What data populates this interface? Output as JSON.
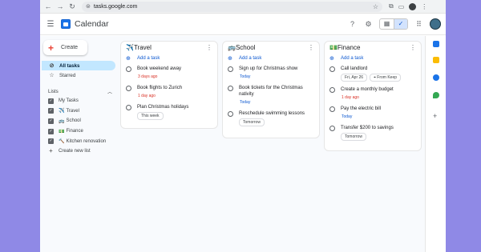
{
  "browser": {
    "url": "tasks.google.com"
  },
  "header": {
    "app_title": "Calendar"
  },
  "sidebar": {
    "create_label": "Create",
    "all_tasks": "All tasks",
    "starred": "Starred",
    "lists_label": "Lists",
    "lists": [
      {
        "emoji": "",
        "label": "My Tasks"
      },
      {
        "emoji": "✈️",
        "label": "Travel"
      },
      {
        "emoji": "🚌",
        "label": "School"
      },
      {
        "emoji": "💵",
        "label": "Finance"
      },
      {
        "emoji": "🔨",
        "label": "Kitchen renovation"
      }
    ],
    "create_new_list": "Create new list"
  },
  "boards": [
    {
      "title": "✈️Travel",
      "add_task": "Add a task",
      "tasks": [
        {
          "title": "Book weekend away",
          "chip": "3 days ago",
          "chip_kind": "red"
        },
        {
          "title": "Book flights to Zurich",
          "chip": "1 day ago",
          "chip_kind": "red"
        },
        {
          "title": "Plan Christmas holidays",
          "chip": "This week",
          "chip_kind": "gray"
        }
      ]
    },
    {
      "title": "🚌School",
      "add_task": "Add a task",
      "tasks": [
        {
          "title": "Sign up for Christmas show",
          "chip": "Today",
          "chip_kind": "blue"
        },
        {
          "title": "Book tickets for the Christmas nativity",
          "chip": "Today",
          "chip_kind": "blue"
        },
        {
          "title": "Reschedule swimming lessons",
          "chip": "Tomorrow",
          "chip_kind": "gray"
        }
      ]
    },
    {
      "title": "💵Finance",
      "add_task": "Add a task",
      "tasks": [
        {
          "title": "Call landlord",
          "chip": "Fri, Apr 26",
          "chip_kind": "gray",
          "chip2": "From Keep"
        },
        {
          "title": "Create a monthly budget",
          "chip": "1 day ago",
          "chip_kind": "red"
        },
        {
          "title": "Pay the electric bill",
          "chip": "Today",
          "chip_kind": "blue"
        },
        {
          "title": "Transfer $200 to savings",
          "chip": "Tomorrow",
          "chip_kind": "gray"
        }
      ]
    }
  ],
  "colors": {
    "background": "#8f89e6",
    "accent": "#0b57d0",
    "overdue": "#d93025",
    "selected_nav": "#c2e7ff"
  }
}
